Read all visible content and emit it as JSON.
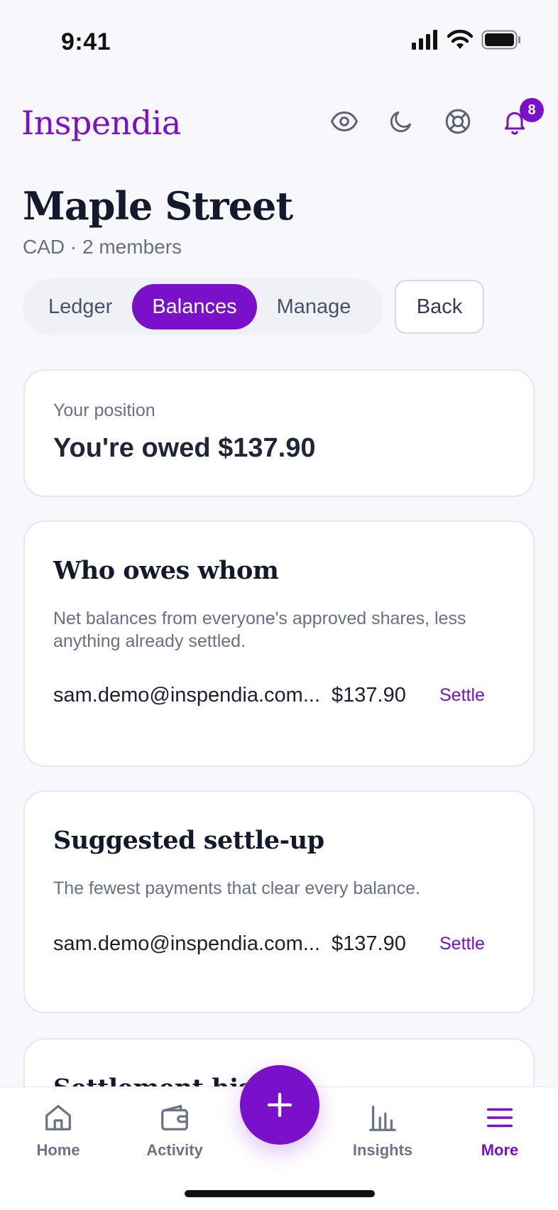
{
  "status_bar": {
    "time": "9:41"
  },
  "app": {
    "brand": "Inspendia",
    "notification_count": "8"
  },
  "header": {
    "title": "Maple Street",
    "subtitle": "CAD · 2 members"
  },
  "tabs": [
    {
      "label": "Ledger",
      "active": false
    },
    {
      "label": "Balances",
      "active": true
    },
    {
      "label": "Manage",
      "active": false
    }
  ],
  "back_label": "Back",
  "position_card": {
    "label": "Your position",
    "value": "You're owed $137.90"
  },
  "owes_card": {
    "title": "Who owes whom",
    "description": "Net balances from everyone's approved shares, less anything already settled.",
    "rows": [
      {
        "email": "sam.demo@inspendia.com...",
        "amount": "$137.90",
        "action": "Settle"
      }
    ]
  },
  "suggest_card": {
    "title": "Suggested settle-up",
    "description": "The fewest payments that clear every balance.",
    "rows": [
      {
        "email": "sam.demo@inspendia.com...",
        "amount": "$137.90",
        "action": "Settle"
      }
    ]
  },
  "history_card": {
    "title": "Settlement history"
  },
  "bottom_nav": {
    "items": [
      {
        "label": "Home",
        "icon": "home-icon"
      },
      {
        "label": "Activity",
        "icon": "wallet-icon"
      },
      {
        "label": "Insights",
        "icon": "bar-chart-icon"
      },
      {
        "label": "More",
        "icon": "menu-icon"
      }
    ],
    "fab_icon": "plus-icon"
  },
  "colors": {
    "accent": "#7a10c9",
    "muted": "#667088",
    "background": "#f8f8fc"
  }
}
